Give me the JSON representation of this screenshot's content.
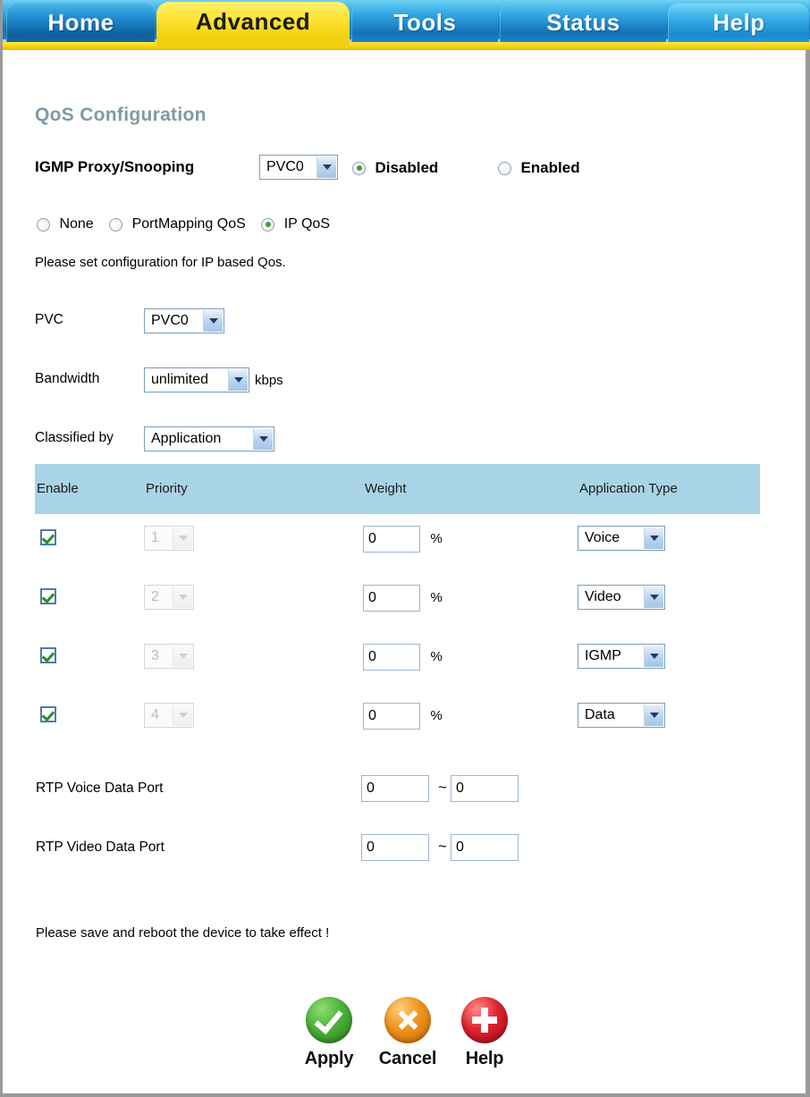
{
  "nav": {
    "tabs": [
      {
        "label": "Home",
        "active": false
      },
      {
        "label": "Advanced",
        "active": true
      },
      {
        "label": "Tools",
        "active": false
      },
      {
        "label": "Status",
        "active": false
      },
      {
        "label": "Help",
        "active": false
      }
    ]
  },
  "page": {
    "title": "QoS Configuration"
  },
  "igmp": {
    "label": "IGMP Proxy/Snooping",
    "pvc_value": "PVC0",
    "options": [
      {
        "label": "Disabled",
        "selected": true
      },
      {
        "label": "Enabled",
        "selected": false
      }
    ]
  },
  "qos_mode": {
    "options": [
      {
        "label": "None",
        "selected": false
      },
      {
        "label": "PortMapping QoS",
        "selected": false
      },
      {
        "label": "IP QoS",
        "selected": true
      }
    ],
    "note": "Please set configuration for IP based Qos."
  },
  "fields": {
    "pvc": {
      "label": "PVC",
      "value": "PVC0"
    },
    "bandwidth": {
      "label": "Bandwidth",
      "value": "unlimited",
      "unit": "kbps"
    },
    "classified_by": {
      "label": "Classified by",
      "value": "Application"
    }
  },
  "table": {
    "headers": [
      "Enable",
      "Priority",
      "Weight",
      "Application Type"
    ],
    "rows": [
      {
        "enabled": true,
        "priority": "1",
        "weight": "0",
        "weight_unit": "%",
        "app_type": "Voice"
      },
      {
        "enabled": true,
        "priority": "2",
        "weight": "0",
        "weight_unit": "%",
        "app_type": "Video"
      },
      {
        "enabled": true,
        "priority": "3",
        "weight": "0",
        "weight_unit": "%",
        "app_type": "IGMP"
      },
      {
        "enabled": true,
        "priority": "4",
        "weight": "0",
        "weight_unit": "%",
        "app_type": "Data"
      }
    ]
  },
  "rtp": {
    "voice": {
      "label": "RTP Voice Data Port",
      "from": "0",
      "separator": "~",
      "to": "0"
    },
    "video": {
      "label": "RTP Video Data Port",
      "from": "0",
      "separator": "~",
      "to": "0"
    }
  },
  "footer": {
    "note": "Please save and reboot the device to take effect !",
    "buttons": [
      {
        "label": "Apply",
        "icon": "check-circle-icon",
        "color": "#4eb33a"
      },
      {
        "label": "Cancel",
        "icon": "x-circle-icon",
        "color": "#f0951f"
      },
      {
        "label": "Help",
        "icon": "plus-circle-icon",
        "color": "#e0242f"
      }
    ]
  }
}
